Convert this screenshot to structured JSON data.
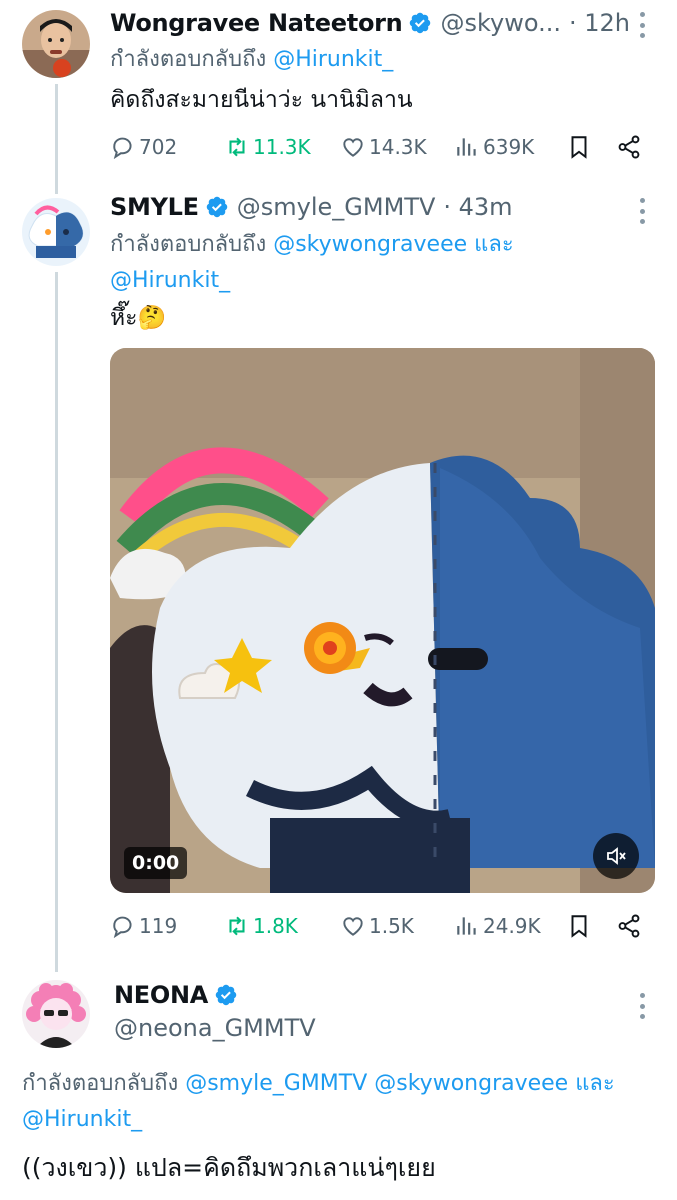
{
  "tweets": [
    {
      "name": "Wongravee Nateetorn",
      "handle": "@skywo...",
      "time": "· 12h",
      "reply_prefix": "กำลังตอบกลับถึง",
      "mentions": [
        "@Hirunkit_"
      ],
      "text": "คิดถึงสะมายนีน่าว่ะ นานิมิลาน",
      "stats": {
        "replies": "702",
        "reposts": "11.3K",
        "likes": "14.3K",
        "views": "639K"
      }
    },
    {
      "name": "SMYLE",
      "handle": "@smyle_GMMTV",
      "time": "· 43m",
      "reply_prefix": "กำลังตอบกลับถึง",
      "mentions": [
        "@skywongraveee",
        "@Hirunkit_"
      ],
      "conjunction": "และ",
      "text": "หึ๊ะ🤔",
      "video": {
        "timestamp": "0:00",
        "muted": true
      },
      "stats": {
        "replies": "119",
        "reposts": "1.8K",
        "likes": "1.5K",
        "views": "24.9K"
      }
    },
    {
      "name": "NEONA",
      "handle": "@neona_GMMTV",
      "reply_prefix": "กำลังตอบกลับถึง",
      "mentions": [
        "@smyle_GMMTV",
        "@skywongraveee",
        "@Hirunkit_"
      ],
      "conjunction": "และ",
      "text": "((วงเขว)) แปล=คิดถึมพวกเลาแน่ๆเยย"
    }
  ],
  "colors": {
    "accent": "#1d9bf0",
    "repost": "#00ba7c",
    "muted_text": "#536471",
    "thread_line": "#cfd9de"
  }
}
